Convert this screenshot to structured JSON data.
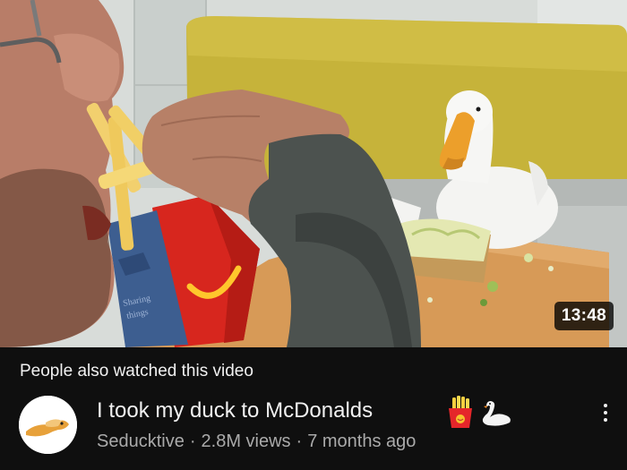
{
  "video": {
    "duration": "13:48",
    "thumbnail_icon": "duck-mcdonalds-thumbnail"
  },
  "section": {
    "heading": "People also watched this video"
  },
  "item": {
    "title": "I took my duck to McDonalds",
    "title_emojis": [
      "french-fries-icon",
      "swan-icon"
    ],
    "channel": "Seducktive",
    "views": "2.8M views",
    "age": "7 months ago",
    "separator": "·"
  },
  "colors": {
    "background": "#0f0f0f",
    "primary_text": "#f1f1f1",
    "secondary_text": "#aaaaaa",
    "fries_box_red": "#d7261e",
    "arch_yellow": "#ffc72c"
  }
}
